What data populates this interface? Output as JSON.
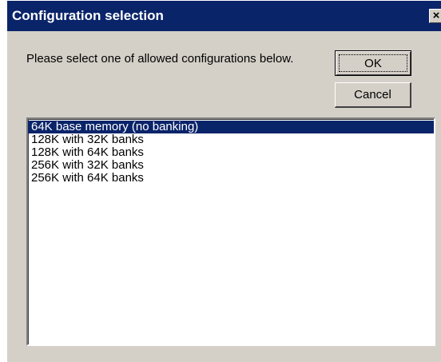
{
  "window": {
    "title": "Configuration selection",
    "close_glyph": "×"
  },
  "prompt": "Please select one of allowed configurations below.",
  "buttons": {
    "ok_label": "OK",
    "cancel_label": "Cancel"
  },
  "list": {
    "items": [
      {
        "label": "64K base memory (no banking)",
        "selected": true
      },
      {
        "label": "128K with 32K banks",
        "selected": false
      },
      {
        "label": "128K with 64K banks",
        "selected": false
      },
      {
        "label": "256K with 32K banks",
        "selected": false
      },
      {
        "label": "256K with 64K banks",
        "selected": false
      }
    ]
  },
  "colors": {
    "title_bar": "#0a246a",
    "selection": "#0a246a",
    "face": "#d4d0c8"
  }
}
